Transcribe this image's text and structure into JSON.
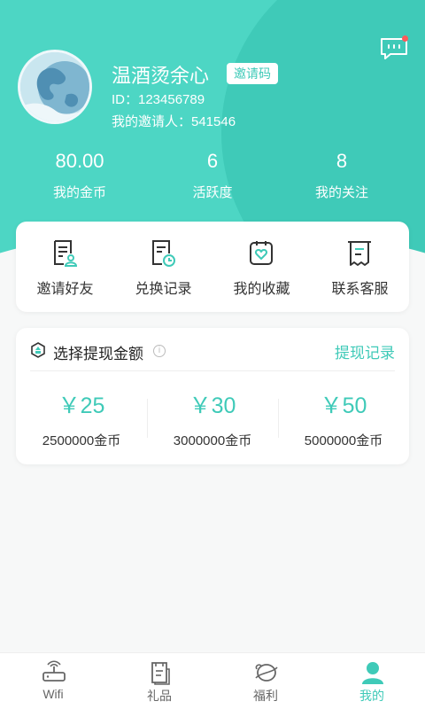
{
  "colors": {
    "accent": "#3fcab8",
    "header_bg": "#4dd6c4",
    "badge_dot": "#ff5a5a"
  },
  "profile": {
    "username": "温酒烫余心",
    "invite_code_label": "邀请码",
    "id_text": "ID：123456789",
    "inviter_text": "我的邀请人：541546"
  },
  "stats": [
    {
      "value": "80.00",
      "label": "我的金币"
    },
    {
      "value": "6",
      "label": "活跃度"
    },
    {
      "value": "8",
      "label": "我的关注"
    }
  ],
  "menu": [
    {
      "label": "邀请好友",
      "icon": "invite-document-icon"
    },
    {
      "label": "兑换记录",
      "icon": "exchange-record-icon"
    },
    {
      "label": "我的收藏",
      "icon": "heart-bag-icon"
    },
    {
      "label": "联系客服",
      "icon": "receipt-icon"
    }
  ],
  "withdraw": {
    "title": "选择提现金额",
    "info_glyph": "i",
    "record_link": "提现记录",
    "options": [
      {
        "price": "￥25",
        "coins": "2500000金币"
      },
      {
        "price": "￥30",
        "coins": "3000000金币"
      },
      {
        "price": "￥50",
        "coins": "5000000金币"
      }
    ]
  },
  "tabs": [
    {
      "label": "Wifi",
      "icon": "router-icon",
      "active": false
    },
    {
      "label": "礼品",
      "icon": "gift-book-icon",
      "active": false
    },
    {
      "label": "福利",
      "icon": "welfare-icon",
      "active": false
    },
    {
      "label": "我的",
      "icon": "user-icon",
      "active": true
    }
  ]
}
